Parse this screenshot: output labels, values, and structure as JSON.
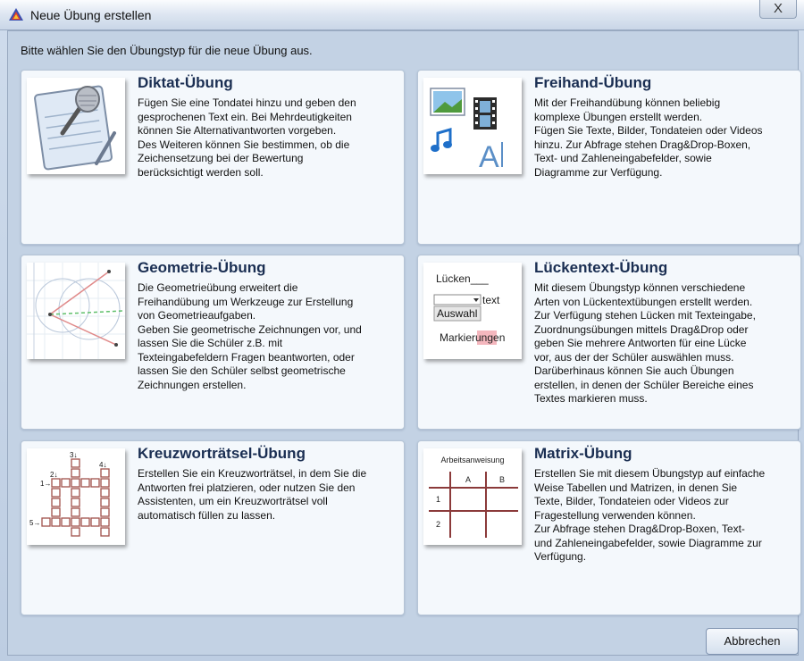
{
  "window": {
    "title": "Neue Übung erstellen",
    "close_label": "X"
  },
  "instruction": "Bitte wählen Sie den Übungstyp für die neue Übung aus.",
  "exercise_types": [
    {
      "title": "Diktat-Übung",
      "description": "Fügen Sie eine Tondatei hinzu und geben den\ngesprochenen Text ein. Bei Mehrdeutigkeiten\nkönnen Sie Alternativantworten vorgeben.\nDes Weiteren können Sie bestimmen, ob die\nZeichensetzung bei der Bewertung\nberücksichtigt werden soll.",
      "icon": "microphone-notepad-icon"
    },
    {
      "title": "Freihand-Übung",
      "description": "Mit der Freihandübung können beliebig\nkomplexe Übungen erstellt werden.\nFügen Sie Texte, Bilder, Tondateien oder Videos\nhinzu. Zur Abfrage stehen Drag&Drop-Boxen,\nText- und Zahleneingabefelder, sowie\nDiagramme zur Verfügung.",
      "icon": "media-collage-icon",
      "thumb_text": "A"
    },
    {
      "title": "Geometrie-Übung",
      "description": "Die Geometrieübung erweitert die\nFreihandübung um Werkzeuge zur Erstellung\nvon Geometrieaufgaben.\nGeben Sie geometrische Zeichnungen vor, und\nlassen Sie die Schüler z.B. mit\nTexteingabefeldern Fragen beantworten, oder\nlassen Sie den Schüler selbst geometrische\nZeichnungen erstellen.",
      "icon": "geometry-drawing-icon"
    },
    {
      "title": "Lückentext-Übung",
      "description": "Mit diesem Übungstyp können verschiedene\nArten von Lückentextübungen erstellt werden.\nZur Verfügung stehen Lücken mit Texteingabe,\nZuordnungsübungen mittels Drag&Drop oder\ngeben Sie mehrere Antworten für eine Lücke\nvor, aus der der Schüler auswählen muss.\nDarüberhinaus können Sie auch Übungen\nerstellen, in denen der Schüler Bereiche eines\nTextes markieren muss.",
      "icon": "cloze-text-icon",
      "thumb_labels": {
        "gap": "Lücken___",
        "text": "text",
        "select": "Auswahl",
        "mark_before": "Markie",
        "mark_highlight": "run",
        "mark_after": "gen"
      }
    },
    {
      "title": "Kreuzworträtsel-Übung",
      "description": "Erstellen Sie ein Kreuzworträtsel, in dem Sie die\nAntworten frei platzieren, oder nutzen Sie den\nAssistenten, um ein Kreuzworträtsel voll\nautomatisch füllen zu lassen.",
      "icon": "crossword-grid-icon",
      "thumb_labels": {
        "clue1": "1→",
        "clue2": "2↓",
        "clue3": "3↓",
        "clue4": "4↓",
        "clue5": "5→"
      }
    },
    {
      "title": "Matrix-Übung",
      "description": "Erstellen Sie mit diesem Übungstyp auf einfache\nWeise Tabellen und Matrizen, in denen Sie\nTexte, Bilder, Tondateien oder Videos zur\nFragestellung verwenden können.\nZur Abfrage stehen Drag&Drop-Boxen, Text-\nund Zahleneingabefelder, sowie Diagramme zur\nVerfügung.",
      "icon": "matrix-table-icon",
      "thumb_labels": {
        "heading": "Arbeitsanweisung",
        "col_a": "A",
        "col_b": "B",
        "row_1": "1",
        "row_2": "2"
      }
    }
  ],
  "buttons": {
    "cancel": "Abbrechen"
  },
  "colors": {
    "title_text": "#1a2e52",
    "card_bg": "#f4f8fc",
    "client_bg": "#c3d2e4"
  }
}
